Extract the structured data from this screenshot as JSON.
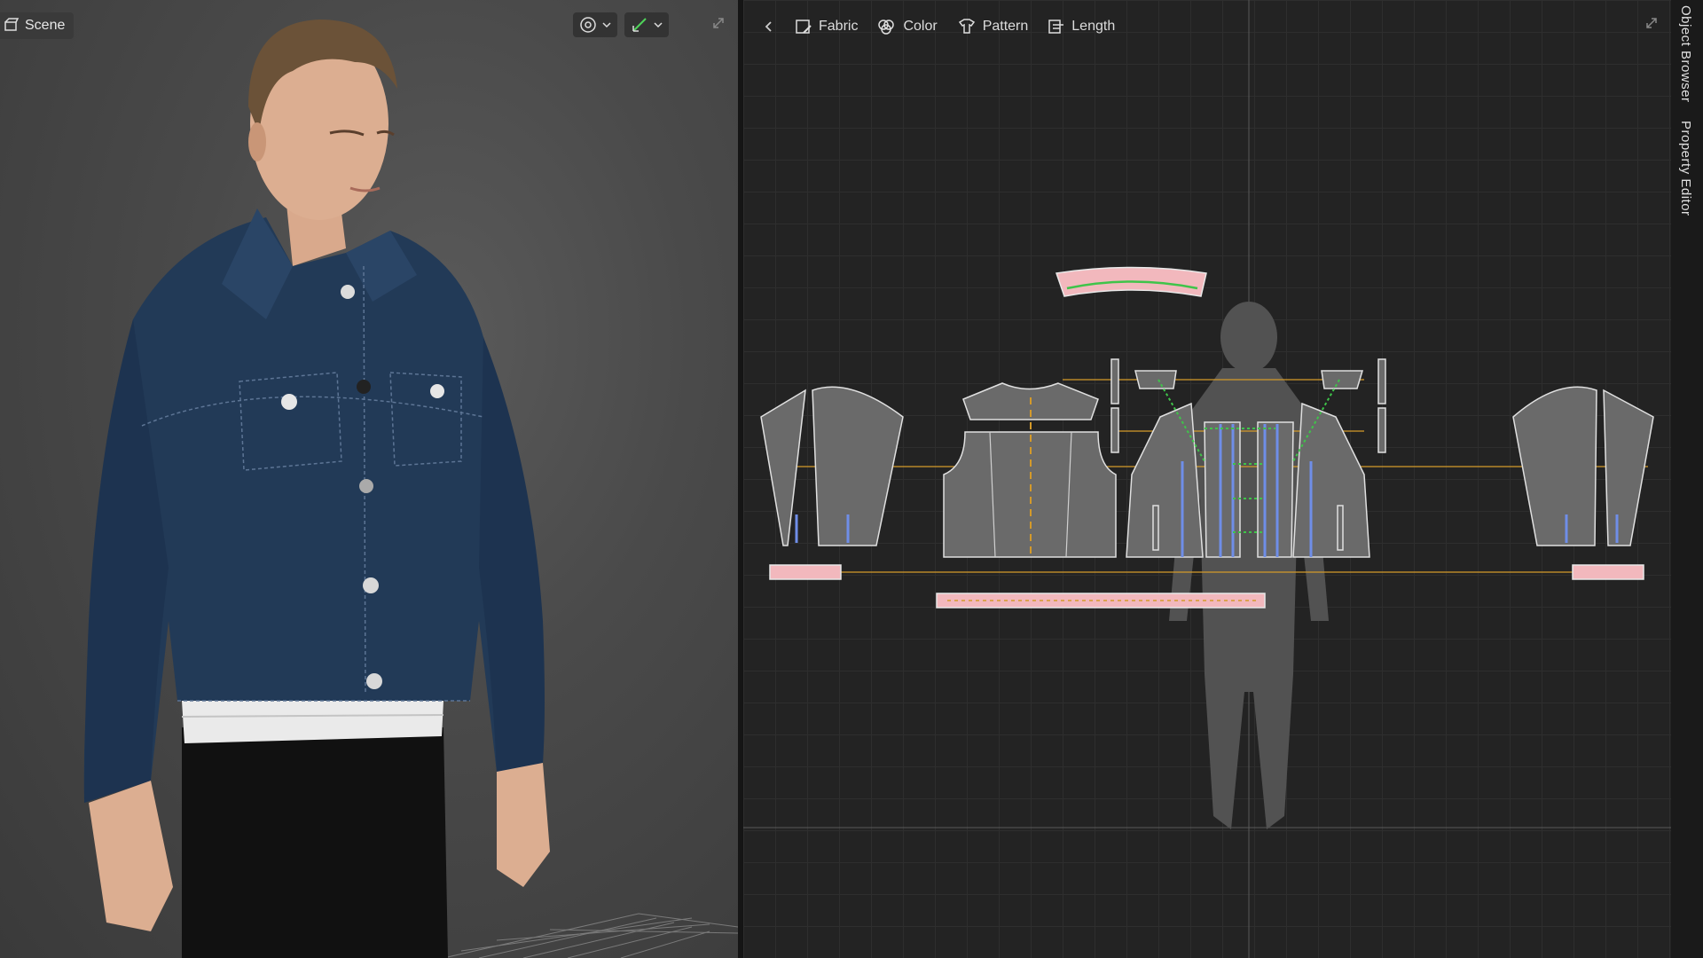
{
  "viewport": {
    "scene_label": "Scene",
    "scene_icon": "scene-icon",
    "tool_icons": [
      "camera-orbit-icon",
      "measure-icon"
    ]
  },
  "pattern_window": {
    "toolbar": [
      {
        "label": "Fabric",
        "icon": "fabric-icon"
      },
      {
        "label": "Color",
        "icon": "color-icon"
      },
      {
        "label": "Pattern",
        "icon": "pattern-icon"
      },
      {
        "label": "Length",
        "icon": "length-icon"
      }
    ]
  },
  "side_tabs": [
    "Object Browser",
    "Property Editor"
  ],
  "colors": {
    "denim": "#223a57",
    "pattern_piece": "#6a6a6a",
    "seam_line": "#d49a2a",
    "sewing_line": "#3fc44a",
    "trim_piece": "#f2b8bd",
    "notch": "#6f8ee8",
    "avatar_silhouette": "#525252"
  }
}
